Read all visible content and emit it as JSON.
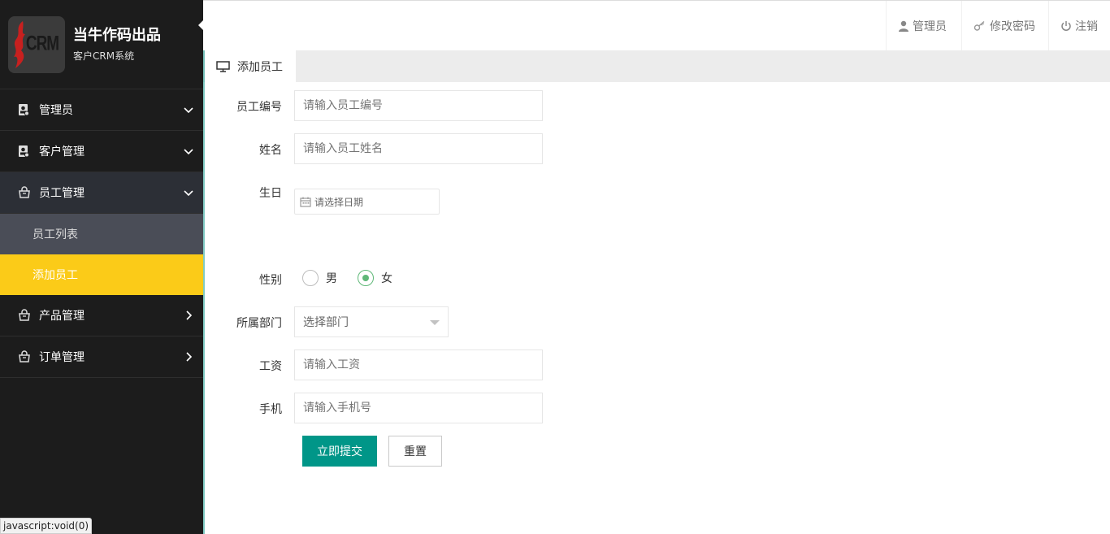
{
  "brand": {
    "title": "当牛作码出品",
    "subtitle": "客户CRM系统",
    "logo_text": "CRM"
  },
  "sidebar": {
    "items": [
      {
        "label": "管理员",
        "icon": "user-card-icon",
        "state": "collapsed"
      },
      {
        "label": "客户管理",
        "icon": "user-card-icon",
        "state": "collapsed"
      },
      {
        "label": "员工管理",
        "icon": "basket-icon",
        "state": "expanded",
        "children": [
          {
            "label": "员工列表",
            "active": false
          },
          {
            "label": "添加员工",
            "active": true
          }
        ]
      },
      {
        "label": "产品管理",
        "icon": "basket-icon",
        "state": "closed"
      },
      {
        "label": "订单管理",
        "icon": "basket-icon",
        "state": "closed"
      }
    ]
  },
  "topbar": {
    "admin": "管理员",
    "change_password": "修改密码",
    "logout": "注销"
  },
  "tab": {
    "label": "添加员工",
    "icon": "monitor-icon"
  },
  "form": {
    "employee_id": {
      "label": "员工编号",
      "placeholder": "请输入员工编号"
    },
    "name": {
      "label": "姓名",
      "placeholder": "请输入员工姓名"
    },
    "birthday": {
      "label": "生日",
      "placeholder": "请选择日期"
    },
    "gender": {
      "label": "性别",
      "options": [
        "男",
        "女"
      ],
      "selected": "女"
    },
    "department": {
      "label": "所属部门",
      "placeholder": "选择部门"
    },
    "salary": {
      "label": "工资",
      "placeholder": "请输入工资"
    },
    "phone": {
      "label": "手机",
      "placeholder": "请输入手机号"
    },
    "submit_label": "立即提交",
    "reset_label": "重置"
  },
  "status_bar": "javascript:void(0)",
  "colors": {
    "sidebar_bg": "#1c1c1c",
    "active_yellow": "#fbcb18",
    "primary_teal": "#009688",
    "radio_green": "#5fb878"
  }
}
